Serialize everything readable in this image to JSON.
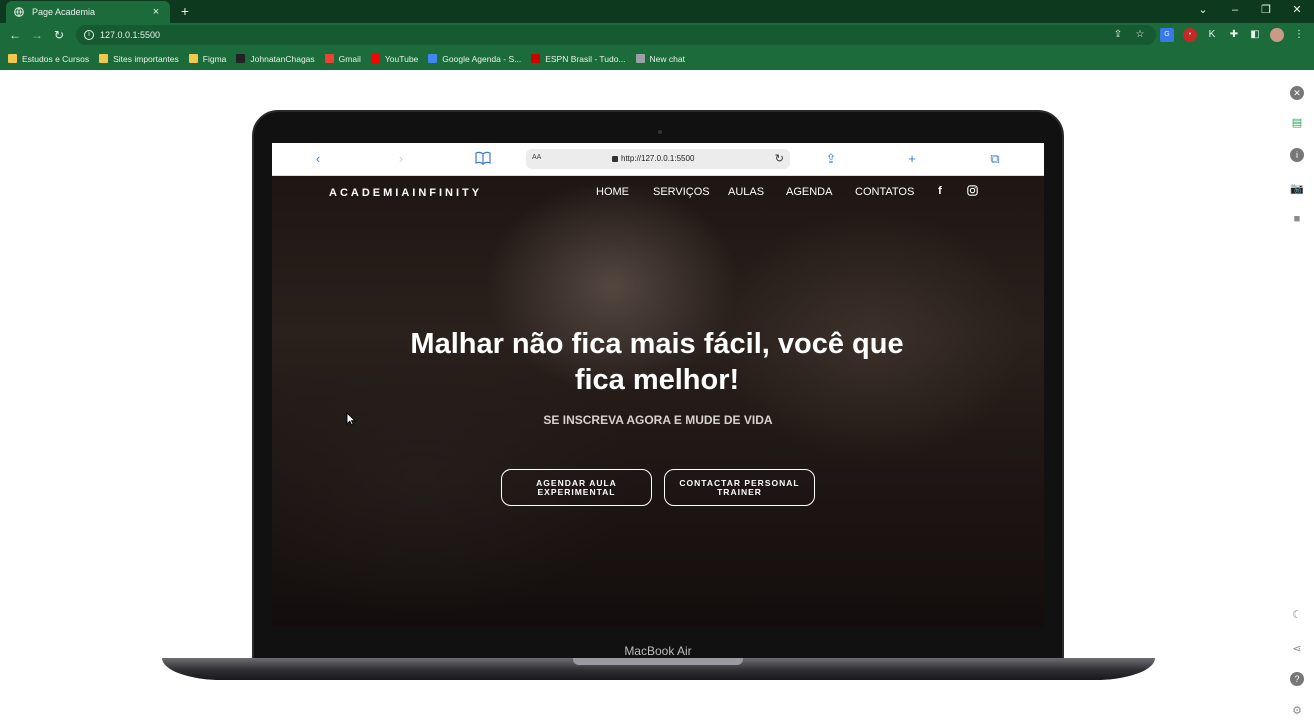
{
  "browser": {
    "tab_title": "Page Academia",
    "tab_close": "×",
    "new_tab": "+",
    "window_controls": [
      "–",
      "❐",
      "✕"
    ],
    "address_url": "127.0.0.1:5500",
    "bookmarks": [
      {
        "label": "Estudos e Cursos",
        "icon": "folder-icon",
        "color": "#f2c94c"
      },
      {
        "label": "Sites importantes",
        "icon": "folder-icon",
        "color": "#f2c94c"
      },
      {
        "label": "Figma",
        "icon": "folder-icon",
        "color": "#f2c94c"
      },
      {
        "label": "JohnatanChagas",
        "icon": "github-icon",
        "color": "#222222"
      },
      {
        "label": "Gmail",
        "icon": "gmail-icon",
        "color": "#ea4335"
      },
      {
        "label": "YouTube",
        "icon": "youtube-icon",
        "color": "#ff0000"
      },
      {
        "label": "Google Agenda - S...",
        "icon": "calendar-icon",
        "color": "#4285f4"
      },
      {
        "label": "ESPN Brasil - Tudo...",
        "icon": "espn-icon",
        "color": "#d00000"
      },
      {
        "label": "New chat",
        "icon": "chatgpt-icon",
        "color": "#9aa0a6"
      }
    ]
  },
  "device": {
    "label": "MacBook Air"
  },
  "safari": {
    "aa_label": "AA",
    "url": "http://127.0.0.1:5500"
  },
  "site": {
    "logo": "ACADEMIAINFINITY",
    "nav": [
      "HOME",
      "SERVIÇOS",
      "AULAS",
      "AGENDA",
      "CONTATOS"
    ],
    "hero_title": "Malhar não fica mais fácil, você que fica melhor!",
    "hero_subtitle": "SE INSCREVA AGORA E MUDE DE VIDA",
    "cta_primary": "AGENDAR AULA EXPERIMENTAL",
    "cta_secondary": "CONTACTAR PERSONAL TRAINER"
  },
  "colors": {
    "chrome_dark": "#0d3a1f",
    "chrome_green": "#1c6b3a",
    "site_bg": "#1f1614"
  }
}
